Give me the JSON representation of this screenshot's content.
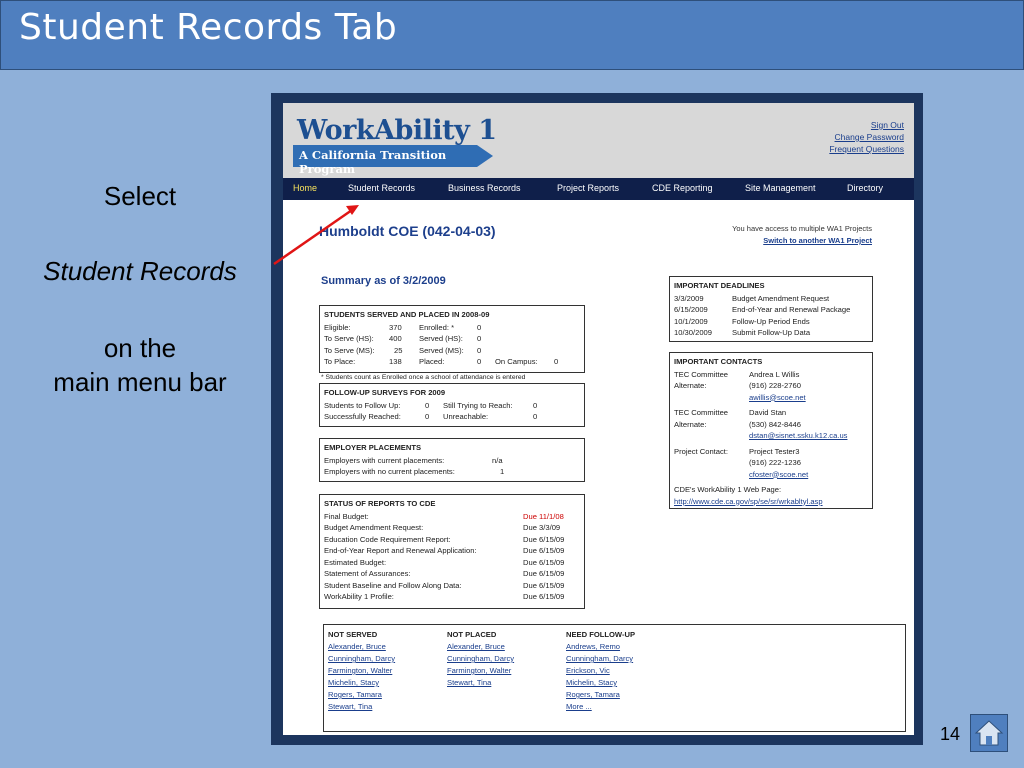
{
  "slide": {
    "title": "Student Records Tab",
    "callout": [
      "Select",
      "Student Records",
      "on the",
      "main menu bar"
    ],
    "page_number": "14",
    "home_icon": "home-icon"
  },
  "app": {
    "logo": {
      "top": "WorkAbility 1",
      "sub": "A California Transition Program"
    },
    "header_links": [
      "Sign Out",
      "Change Password",
      "Frequent Questions"
    ],
    "nav": [
      {
        "label": "Home",
        "active": true
      },
      {
        "label": "Student Records",
        "active": false
      },
      {
        "label": "Business Records",
        "active": false
      },
      {
        "label": "Project Reports",
        "active": false
      },
      {
        "label": "CDE Reporting",
        "active": false
      },
      {
        "label": "Site Management",
        "active": false
      },
      {
        "label": "Directory",
        "active": false
      }
    ],
    "org_title": "Humboldt COE (042-04-03)",
    "access_msg": "You have access to multiple WA1 Projects",
    "switch_link": "Switch to another WA1 Project",
    "summary_title": "Summary as of 3/2/2009",
    "served": {
      "title": "STUDENTS SERVED AND PLACED IN 2008-09",
      "rows": [
        [
          "Eligible:",
          "370",
          "Enrolled: *",
          "0",
          "",
          ""
        ],
        [
          "To Serve (HS):",
          "400",
          "Served (HS):",
          "0",
          "",
          ""
        ],
        [
          "To Serve (MS):",
          "25",
          "Served (MS):",
          "0",
          "",
          ""
        ],
        [
          "To Place:",
          "138",
          "Placed:",
          "0",
          "On Campus:",
          "0"
        ]
      ],
      "note": "* Students count as Enrolled once a school of attendance is entered"
    },
    "followup": {
      "title": "FOLLOW-UP SURVEYS FOR 2009",
      "rows": [
        [
          "Students to Follow Up:",
          "0",
          "Still Trying to Reach:",
          "0"
        ],
        [
          "Successfully Reached:",
          "0",
          "Unreachable:",
          "0"
        ]
      ]
    },
    "employer": {
      "title": "EMPLOYER PLACEMENTS",
      "rows": [
        [
          "Employers with current placements:",
          "n/a"
        ],
        [
          "Employers with no current placements:",
          "1"
        ]
      ]
    },
    "reports": {
      "title": "STATUS OF REPORTS TO CDE",
      "rows": [
        {
          "name": "Final Budget:",
          "due": "Due 11/1/08",
          "overdue": true
        },
        {
          "name": "Budget Amendment Request:",
          "due": "Due 3/3/09",
          "overdue": false
        },
        {
          "name": "Education Code Requirement Report:",
          "due": "Due 6/15/09",
          "overdue": false
        },
        {
          "name": "End-of-Year Report and Renewal Application:",
          "due": "Due 6/15/09",
          "overdue": false
        },
        {
          "name": "Estimated Budget:",
          "due": "Due 6/15/09",
          "overdue": false
        },
        {
          "name": "Statement of Assurances:",
          "due": "Due 6/15/09",
          "overdue": false
        },
        {
          "name": "Student Baseline and Follow Along Data:",
          "due": "Due 6/15/09",
          "overdue": false
        },
        {
          "name": "WorkAbility 1 Profile:",
          "due": "Due 6/15/09",
          "overdue": false
        }
      ]
    },
    "deadlines": {
      "title": "IMPORTANT DEADLINES",
      "rows": [
        [
          "3/3/2009",
          "Budget Amendment Request"
        ],
        [
          "6/15/2009",
          "End-of-Year and Renewal Package"
        ],
        [
          "10/1/2009",
          "Follow-Up Period Ends"
        ],
        [
          "10/30/2009",
          "Submit Follow-Up Data"
        ]
      ]
    },
    "contacts": {
      "title": "IMPORTANT CONTACTS",
      "tec1": {
        "label1": "TEC Committee",
        "label2": "Alternate:",
        "name": "Andrea L Willis",
        "phone": "(916) 228-2760",
        "email": "awillis@scoe.net"
      },
      "tec2": {
        "label1": "TEC Committee",
        "label2": "Alternate:",
        "name": "David Stan",
        "phone": "(530) 842-8446",
        "email": "dstan@sisnet.ssku.k12.ca.us"
      },
      "project": {
        "label": "Project Contact:",
        "name": "Project Tester3",
        "phone": "(916) 222-1236",
        "email": "cfoster@scoe.net"
      },
      "web_label": "CDE's WorkAbility 1 Web Page:",
      "web_link": "http://www.cde.ca.gov/sp/se/sr/wrkabltyl.asp"
    },
    "lists": [
      {
        "title": "NOT SERVED",
        "items": [
          "Alexander, Bruce",
          "Cunningham, Darcy",
          "Farmington, Walter",
          "Michelin, Stacy",
          "Rogers, Tamara",
          "Stewart, Tina"
        ]
      },
      {
        "title": "NOT PLACED",
        "items": [
          "Alexander, Bruce",
          "Cunningham, Darcy",
          "Farmington, Walter",
          "Stewart, Tina"
        ]
      },
      {
        "title": "NEED FOLLOW-UP",
        "items": [
          "Andrews, Remo",
          "Cunningham, Darcy",
          "Erickson, Vic",
          "Michelin, Stacy",
          "Rogers, Tamara",
          "More ..."
        ]
      }
    ]
  }
}
